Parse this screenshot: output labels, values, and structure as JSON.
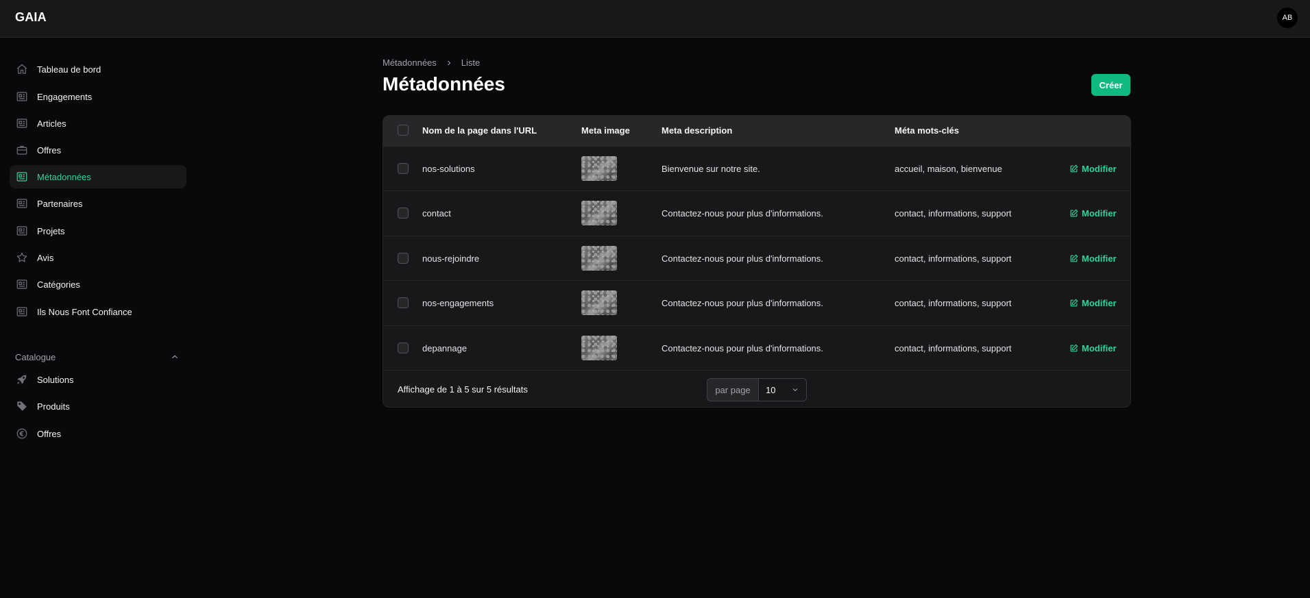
{
  "app": {
    "brand": "GAIA",
    "avatar_initials": "AB"
  },
  "colors": {
    "accent": "#10b981",
    "accent_text": "#34d399",
    "background": "#09090b",
    "surface": "#18181b"
  },
  "sidebar": {
    "items": [
      {
        "label": "Tableau de bord",
        "icon": "home-icon",
        "active": false
      },
      {
        "label": "Engagements",
        "icon": "newspaper-icon",
        "active": false
      },
      {
        "label": "Articles",
        "icon": "newspaper-icon",
        "active": false
      },
      {
        "label": "Offres",
        "icon": "briefcase-icon",
        "active": false
      },
      {
        "label": "Métadonnées",
        "icon": "newspaper-icon",
        "active": true
      },
      {
        "label": "Partenaires",
        "icon": "newspaper-icon",
        "active": false
      },
      {
        "label": "Projets",
        "icon": "newspaper-icon",
        "active": false
      },
      {
        "label": "Avis",
        "icon": "star-icon",
        "active": false
      },
      {
        "label": "Catégories",
        "icon": "newspaper-icon",
        "active": false
      },
      {
        "label": "Ils Nous Font Confiance",
        "icon": "newspaper-icon",
        "active": false
      }
    ],
    "group": {
      "title": "Catalogue",
      "expanded": true,
      "items": [
        {
          "label": "Solutions",
          "icon": "rocket-icon"
        },
        {
          "label": "Produits",
          "icon": "tag-icon"
        },
        {
          "label": "Offres",
          "icon": "euro-icon"
        }
      ]
    }
  },
  "page": {
    "breadcrumb": [
      "Métadonnées",
      "Liste"
    ],
    "title": "Métadonnées",
    "create_label": "Créer"
  },
  "table": {
    "columns": [
      "Nom de la page dans l'URL",
      "Meta image",
      "Meta description",
      "Méta mots-clés"
    ],
    "action_label": "Modifier",
    "rows": [
      {
        "page": "nos-solutions",
        "description": "Bienvenue sur notre site.",
        "keywords": "accueil, maison, bienvenue"
      },
      {
        "page": "contact",
        "description": "Contactez-nous pour plus d'informations.",
        "keywords": "contact, informations, support"
      },
      {
        "page": "nous-rejoindre",
        "description": "Contactez-nous pour plus d'informations.",
        "keywords": "contact, informations, support"
      },
      {
        "page": "nos-engagements",
        "description": "Contactez-nous pour plus d'informations.",
        "keywords": "contact, informations, support"
      },
      {
        "page": "depannage",
        "description": "Contactez-nous pour plus d'informations.",
        "keywords": "contact, informations, support"
      }
    ],
    "footer": {
      "summary": "Affichage de 1 à 5 sur 5 résultats",
      "per_page_label": "par page",
      "per_page_value": "10"
    }
  }
}
